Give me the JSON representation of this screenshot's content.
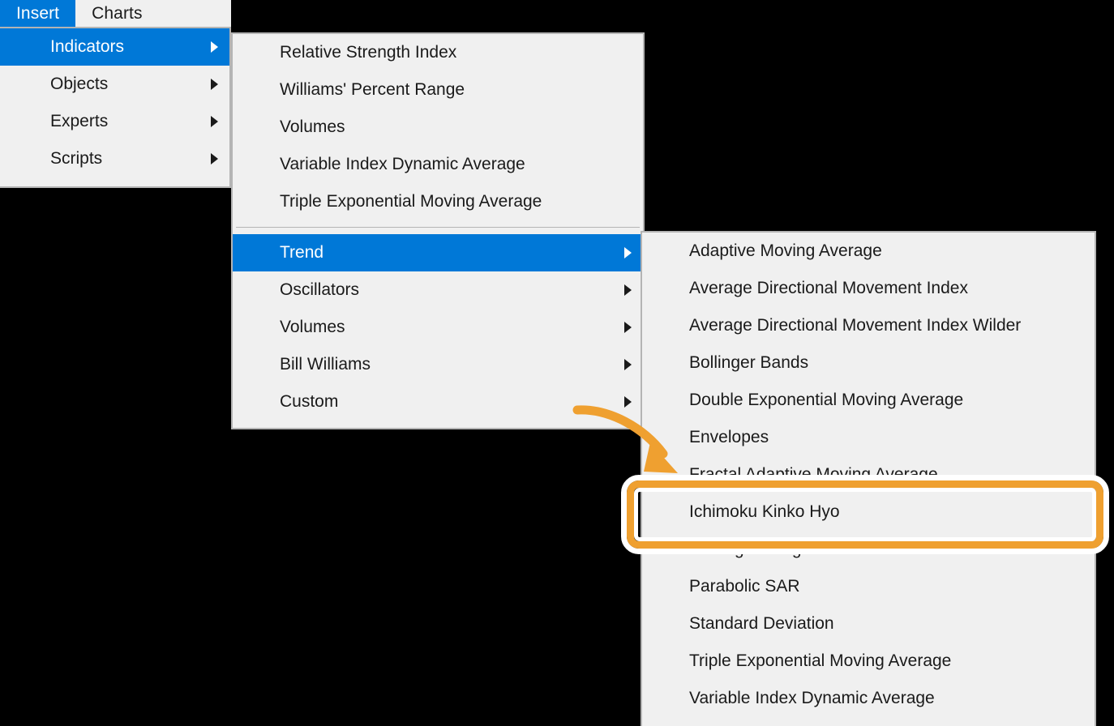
{
  "colors": {
    "accent_blue": "#0078d7",
    "menu_bg": "#f0f0f0",
    "menu_border": "#b4b4b4",
    "text": "#1a1a1a",
    "highlight_orange": "#efa030",
    "desktop": "#000000"
  },
  "menubar": {
    "items": [
      {
        "label": "Insert",
        "active": true
      },
      {
        "label": "Charts",
        "active": false
      }
    ]
  },
  "insert_menu": {
    "items": [
      {
        "label": "Indicators",
        "selected": true,
        "has_submenu": true
      },
      {
        "label": "Objects",
        "selected": false,
        "has_submenu": true
      },
      {
        "label": "Experts",
        "selected": false,
        "has_submenu": true
      },
      {
        "label": "Scripts",
        "selected": false,
        "has_submenu": true
      }
    ]
  },
  "indicators_menu": {
    "top_items": [
      {
        "label": "Relative Strength Index",
        "has_submenu": false
      },
      {
        "label": "Williams' Percent Range",
        "has_submenu": false
      },
      {
        "label": "Volumes",
        "has_submenu": false
      },
      {
        "label": "Variable Index Dynamic Average",
        "has_submenu": false
      },
      {
        "label": "Triple Exponential Moving Average",
        "has_submenu": false
      }
    ],
    "bottom_items": [
      {
        "label": "Trend",
        "selected": true,
        "has_submenu": true
      },
      {
        "label": "Oscillators",
        "selected": false,
        "has_submenu": true
      },
      {
        "label": "Volumes",
        "selected": false,
        "has_submenu": true
      },
      {
        "label": "Bill Williams",
        "selected": false,
        "has_submenu": true
      },
      {
        "label": "Custom",
        "selected": false,
        "has_submenu": true
      }
    ]
  },
  "trend_menu": {
    "items": [
      {
        "label": "Adaptive Moving Average",
        "highlighted": false
      },
      {
        "label": "Average Directional Movement Index",
        "highlighted": false
      },
      {
        "label": "Average Directional Movement Index Wilder",
        "highlighted": false
      },
      {
        "label": "Bollinger Bands",
        "highlighted": false
      },
      {
        "label": "Double Exponential Moving Average",
        "highlighted": false
      },
      {
        "label": "Envelopes",
        "highlighted": false
      },
      {
        "label": "Fractal Adaptive Moving Average",
        "highlighted": false
      },
      {
        "label": "Ichimoku Kinko Hyo",
        "highlighted": true
      },
      {
        "label": "Moving Average",
        "highlighted": false
      },
      {
        "label": "Parabolic SAR",
        "highlighted": false
      },
      {
        "label": "Standard Deviation",
        "highlighted": false
      },
      {
        "label": "Triple Exponential Moving Average",
        "highlighted": false
      },
      {
        "label": "Variable Index Dynamic Average",
        "highlighted": false
      }
    ]
  },
  "annotation": {
    "target_label": "Ichimoku Kinko Hyo",
    "arrow": "curved-arrow-pointing-down-right"
  }
}
